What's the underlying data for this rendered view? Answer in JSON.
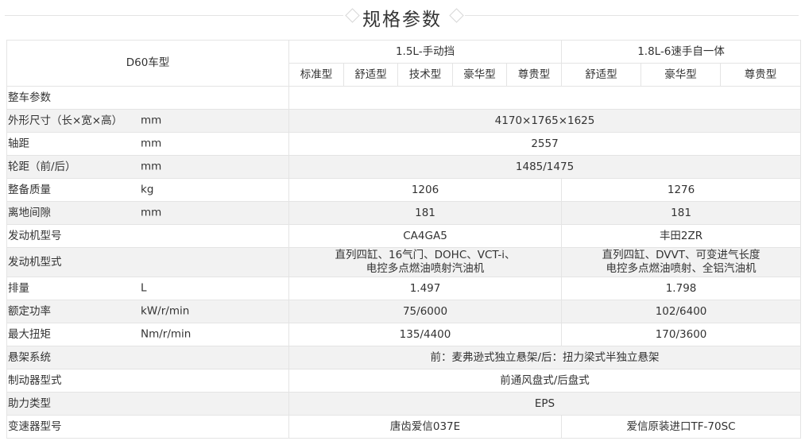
{
  "page_title": "规格参数",
  "header": {
    "model": "D60车型",
    "groups": [
      "1.5L-手动挡",
      "1.8L-6速手自一体"
    ],
    "trims_1": [
      "标准型",
      "舒适型",
      "技术型",
      "豪华型",
      "尊贵型"
    ],
    "trims_2": [
      "舒适型",
      "豪华型",
      "尊贵型"
    ]
  },
  "rows": [
    {
      "label": "整车参数",
      "unit": "",
      "all": ""
    },
    {
      "label": "外形尺寸（长×宽×高）",
      "unit": "mm",
      "all": "4170×1765×1625"
    },
    {
      "label": "轴距",
      "unit": "mm",
      "all": "2557"
    },
    {
      "label": "轮距（前/后）",
      "unit": "mm",
      "all": "1485/1475"
    },
    {
      "label": "整备质量",
      "unit": "kg",
      "g1": "1206",
      "g2": "1276"
    },
    {
      "label": "离地间隙",
      "unit": "mm",
      "g1": "181",
      "g2": "181"
    },
    {
      "label": "发动机型号",
      "unit": "",
      "g1": "CA4GA5",
      "g2": "丰田2ZR"
    },
    {
      "label": "发动机型式",
      "unit": "",
      "g1a": "直列四缸、16气门、DOHC、VCT-i、",
      "g1b": "电控多点燃油喷射汽油机",
      "g2a": "直列四缸、DVVT、可变进气长度",
      "g2b": "电控多点燃油喷射、全铝汽油机"
    },
    {
      "label": "排量",
      "unit": "L",
      "g1": "1.497",
      "g2": "1.798"
    },
    {
      "label": "额定功率",
      "unit": "kW/r/min",
      "g1": "75/6000",
      "g2": "102/6400"
    },
    {
      "label": "最大扭矩",
      "unit": "Nm/r/min",
      "g1": "135/4400",
      "g2": "170/3600"
    },
    {
      "label": "悬架系统",
      "unit": "",
      "all": "前：麦弗逊式独立悬架/后：扭力梁式半独立悬架"
    },
    {
      "label": "制动器型式",
      "unit": "",
      "all": "前通风盘式/后盘式"
    },
    {
      "label": "助力类型",
      "unit": "",
      "all": "EPS"
    },
    {
      "label": "变速器型号",
      "unit": "",
      "g1": "唐齿爱信037E",
      "g2": "爱信原装进口TF-70SC"
    }
  ]
}
